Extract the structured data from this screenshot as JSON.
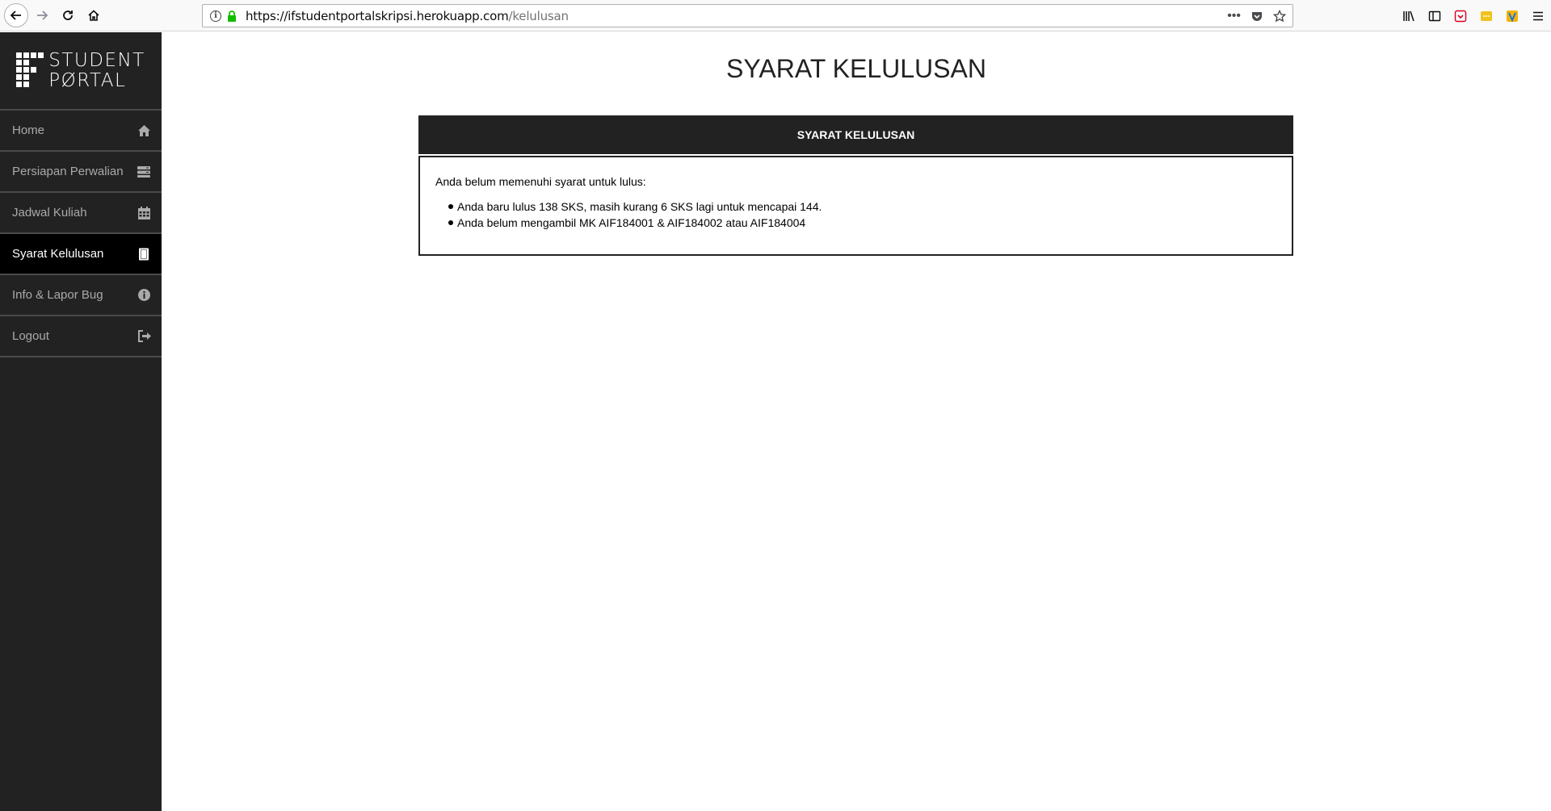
{
  "browser": {
    "url_host": "https://ifstudentportalskripsi.herokuapp.com",
    "url_path": "/kelulusan"
  },
  "logo": {
    "line1": "STUDENT",
    "line2": "PØRTAL"
  },
  "sidebar": {
    "items": [
      {
        "label": "Home",
        "icon": "home-icon",
        "active": false
      },
      {
        "label": "Persiapan Perwalian",
        "icon": "server-icon",
        "active": false
      },
      {
        "label": "Jadwal Kuliah",
        "icon": "calendar-icon",
        "active": false
      },
      {
        "label": "Syarat Kelulusan",
        "icon": "book-icon",
        "active": true
      },
      {
        "label": "Info & Lapor Bug",
        "icon": "info-icon",
        "active": false
      },
      {
        "label": "Logout",
        "icon": "logout-icon",
        "active": false
      }
    ]
  },
  "main": {
    "title": "SYARAT KELULUSAN",
    "panel": {
      "header": "SYARAT KELULUSAN",
      "intro": "Anda belum memenuhi syarat untuk lulus:",
      "items": [
        "Anda baru lulus 138 SKS, masih kurang 6 SKS lagi untuk mencapai 144.",
        "Anda belum mengambil MK AIF184001 & AIF184002 atau AIF184004"
      ]
    }
  },
  "colors": {
    "sidebar_bg": "#222222",
    "active_item_bg": "#000000",
    "panel_header_bg": "#222222"
  }
}
